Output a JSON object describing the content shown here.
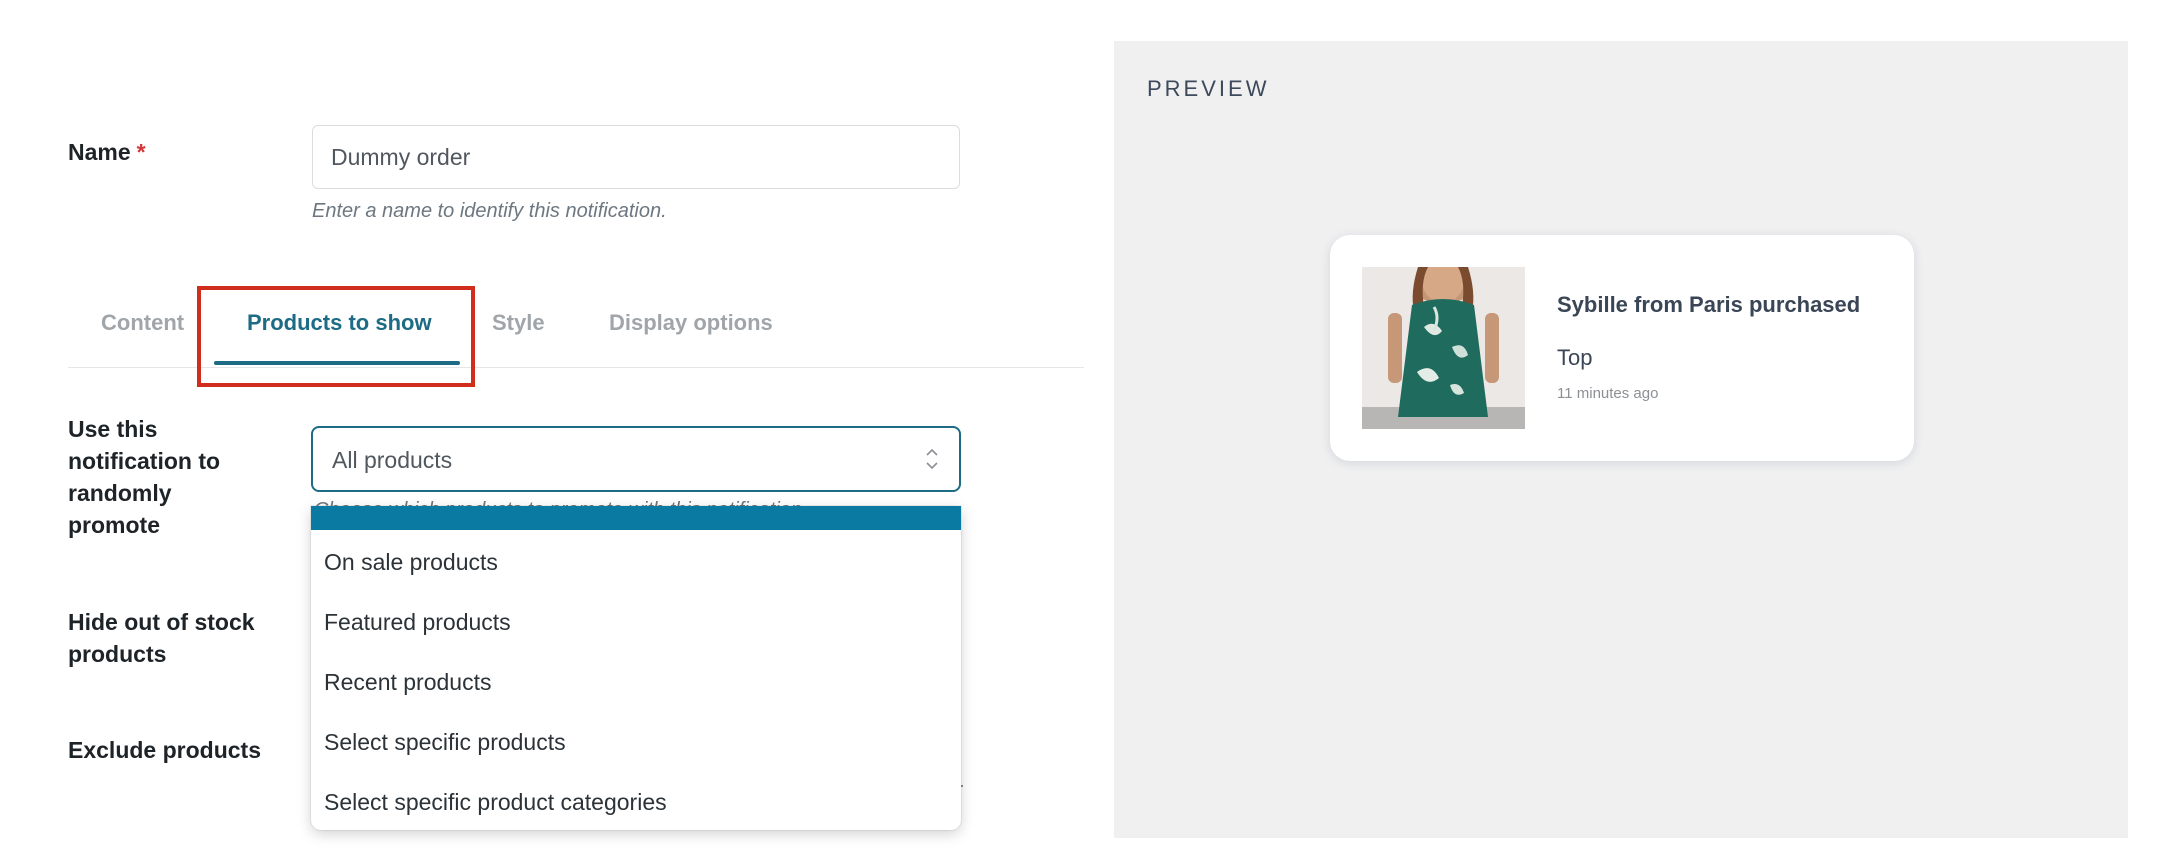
{
  "form": {
    "name": {
      "label": "Name",
      "required_mark": "*",
      "value": "Dummy order",
      "help": "Enter a name to identify this notification."
    },
    "tabs": [
      {
        "label": "Content",
        "active": false
      },
      {
        "label": "Products to show",
        "active": true
      },
      {
        "label": "Style",
        "active": false
      },
      {
        "label": "Display options",
        "active": false
      }
    ],
    "promote": {
      "label": "Use this notification to randomly promote",
      "selected": "All products",
      "help": "Choose which products to promote with this notification."
    },
    "hide_out_of_stock": {
      "label": "Hide out of stock products"
    },
    "exclude_products": {
      "label": "Exclude products"
    }
  },
  "dropdown": {
    "options": [
      "All products",
      "On sale products",
      "Featured products",
      "Recent products",
      "Select specific products",
      "Select specific product categories"
    ],
    "highlighted_index": 0
  },
  "preview": {
    "title": "PREVIEW",
    "notification": {
      "headline": "Sybille from Paris purchased",
      "product": "Top",
      "time": "11 minutes ago"
    }
  },
  "colors": {
    "accent": "#1d6b85",
    "highlight_box": "#d12d1d",
    "dropdown_selected": "#0a7aa3",
    "preview_bg": "#f0f0f1"
  }
}
